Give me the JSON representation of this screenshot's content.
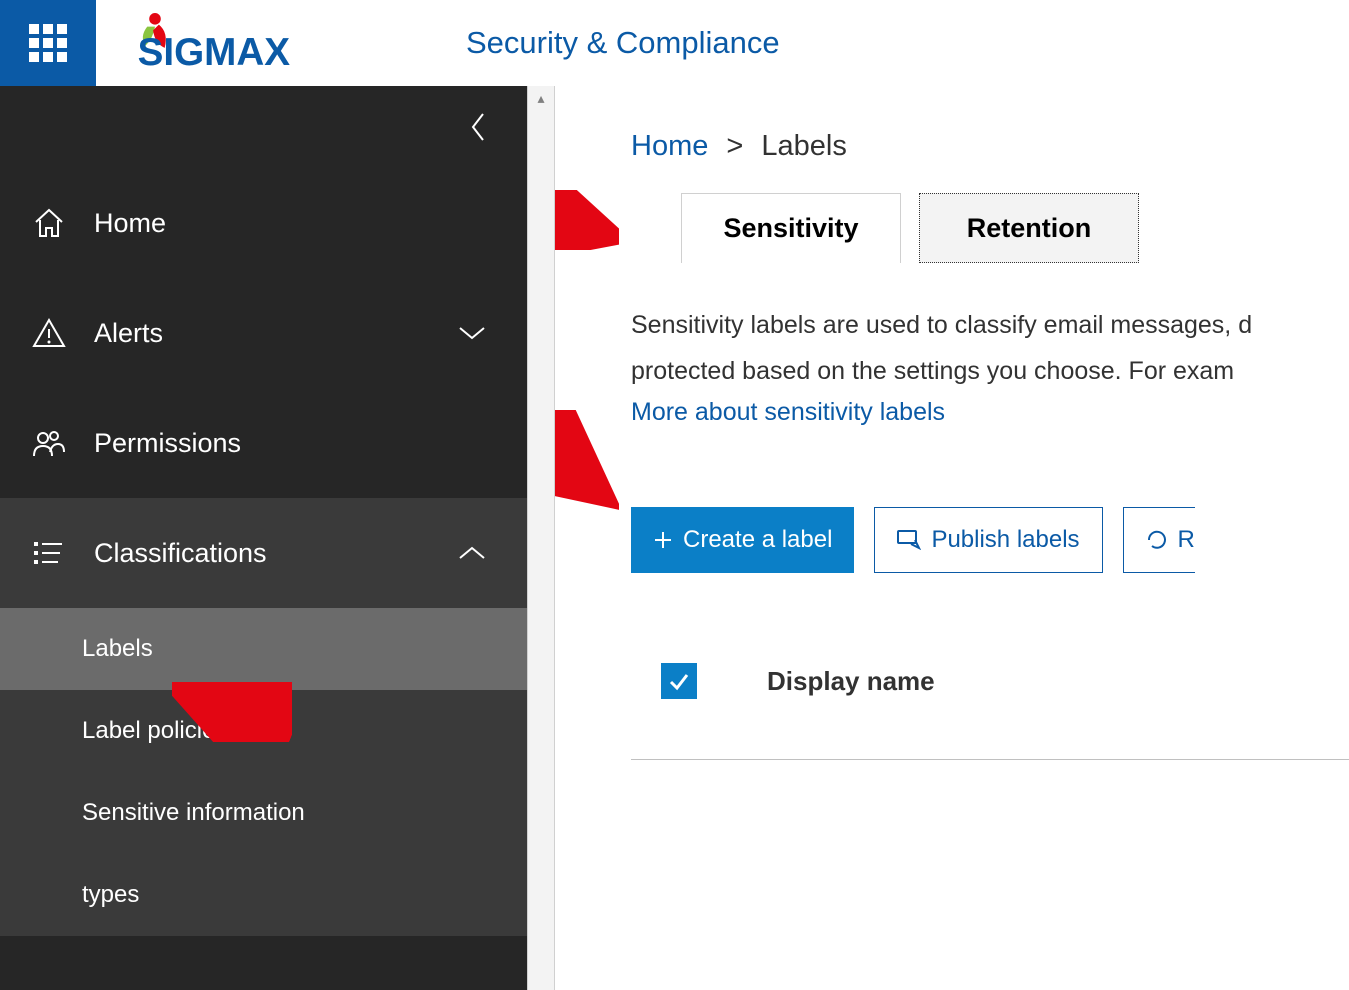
{
  "brand": {
    "name": "SIGMAX",
    "accent": "#0b5aa6",
    "logo_dot": "#e30613",
    "logo_leaf": "#8bc53f"
  },
  "header": {
    "app_title": "Security & Compliance"
  },
  "sidebar": {
    "home": "Home",
    "alerts": "Alerts",
    "permissions": "Permissions",
    "classifications": "Classifications",
    "subitems": {
      "labels": "Labels",
      "label_policies": "Label policies",
      "sensitive_info": "Sensitive information",
      "types": "types"
    }
  },
  "breadcrumb": {
    "home": "Home",
    "current": "Labels",
    "sep": ">"
  },
  "tabs": {
    "sensitivity": "Sensitivity",
    "retention": "Retention"
  },
  "body": {
    "desc_line1": "Sensitivity labels are used to classify email messages, d",
    "desc_line2": "protected based on the settings you choose. For exam",
    "link": "More about sensitivity labels"
  },
  "buttons": {
    "create": "Create a label",
    "publish": "Publish labels",
    "refresh": "R"
  },
  "table": {
    "col1": "Display name"
  }
}
